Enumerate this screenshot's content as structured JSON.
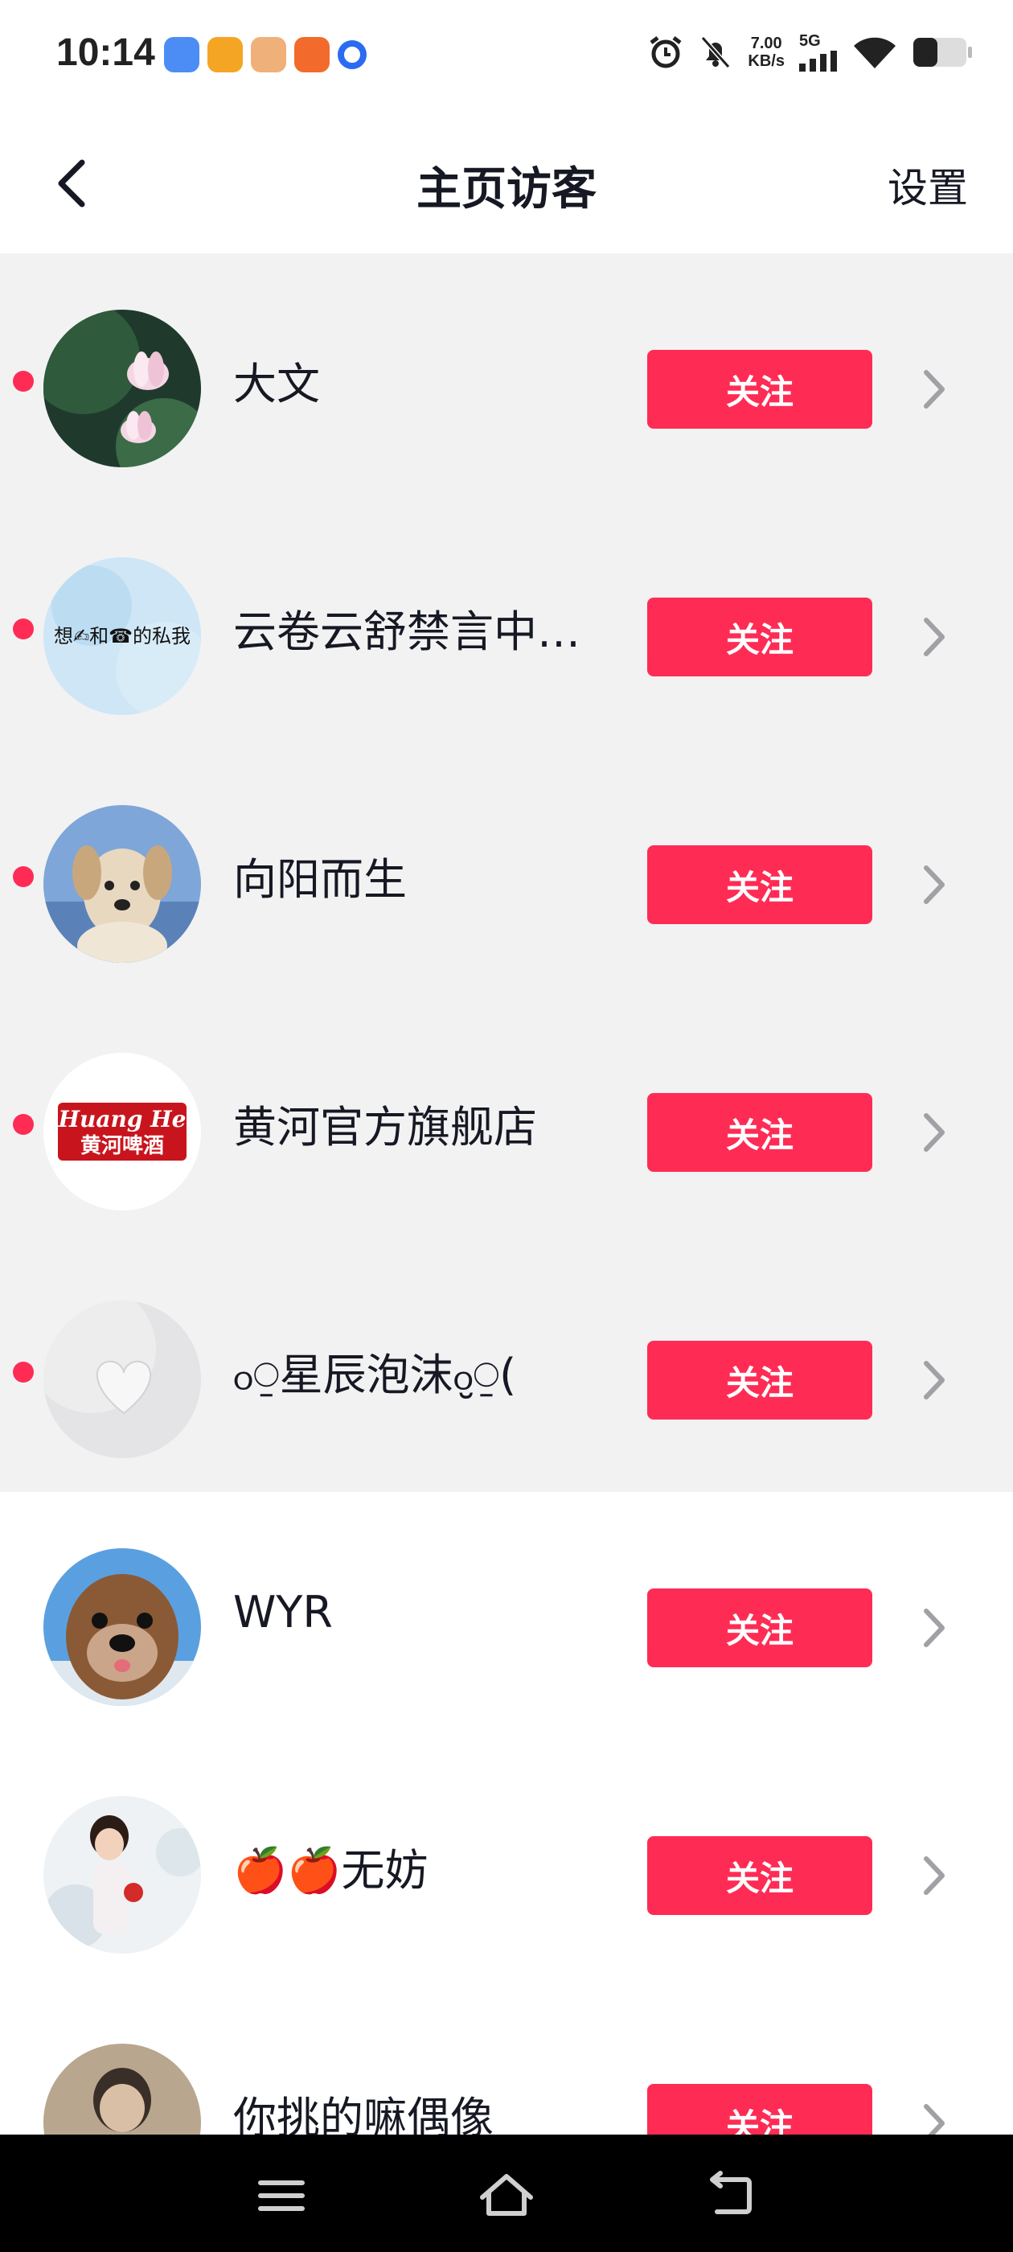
{
  "status_bar": {
    "time": "10:14",
    "net_speed_value": "7.00",
    "net_speed_unit": "KB/s",
    "net_type": "5G"
  },
  "header": {
    "title": "主页访客",
    "settings_label": "设置"
  },
  "colors": {
    "accent": "#fe2c55",
    "unread_bg": "#f2f2f3"
  },
  "visitors": [
    {
      "name": "大文",
      "follow_label": "关注",
      "unread": true
    },
    {
      "name": "云卷云舒禁言中…",
      "follow_label": "关注",
      "unread": true,
      "avatar_text": "想✍和☎的私我"
    },
    {
      "name": "向阳而生",
      "follow_label": "关注",
      "unread": true
    },
    {
      "name": "黄河官方旗舰店",
      "follow_label": "关注",
      "unread": true,
      "avatar_text": "Huang He",
      "avatar_subtext": "黄河啤酒"
    },
    {
      "name": "ჿ⍜星辰泡沫ჿ̮⍜(",
      "follow_label": "关注",
      "unread": true
    },
    {
      "name": "WYR",
      "follow_label": "关注",
      "unread": false
    },
    {
      "name": "🍎🍎无妨",
      "follow_label": "关注",
      "unread": false
    },
    {
      "name": "你挑的嘛偶像",
      "follow_label": "关注",
      "unread": false
    }
  ]
}
